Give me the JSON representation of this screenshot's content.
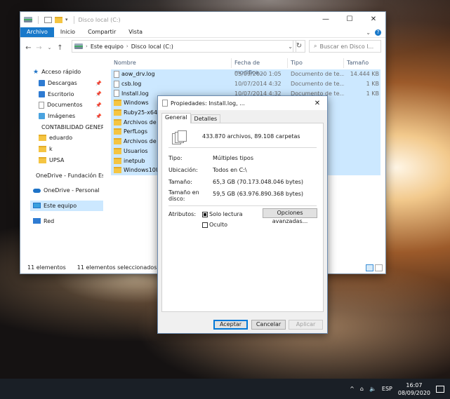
{
  "explorer": {
    "title": "Disco local (C:)",
    "ribbon_tabs": [
      "Archivo",
      "Inicio",
      "Compartir",
      "Vista"
    ],
    "address": [
      "Este equipo",
      "Disco local (C:)"
    ],
    "search_placeholder": "Buscar en Disco l...",
    "sidebar": [
      {
        "label": "Acceso rápido",
        "icon": "star-icon"
      },
      {
        "label": "Descargas",
        "icon": "download-icon",
        "pinned": true
      },
      {
        "label": "Escritorio",
        "icon": "desktop-icon",
        "pinned": true
      },
      {
        "label": "Documentos",
        "icon": "documents-icon",
        "pinned": true
      },
      {
        "label": "Imágenes",
        "icon": "pictures-icon",
        "pinned": true
      },
      {
        "label": "CONTABILIDAD GENER",
        "icon": "folder-icon"
      },
      {
        "label": "eduardo",
        "icon": "folder-icon"
      },
      {
        "label": "k",
        "icon": "folder-icon"
      },
      {
        "label": "UPSA",
        "icon": "folder-icon"
      },
      {
        "label": "OneDrive - Fundación Es",
        "icon": "onedrive-icon"
      },
      {
        "label": "OneDrive - Personal",
        "icon": "onedrive-icon"
      },
      {
        "label": "Este equipo",
        "icon": "this-pc-icon"
      },
      {
        "label": "Red",
        "icon": "network-icon"
      }
    ],
    "columns": [
      "Nombre",
      "Fecha de modifica...",
      "Tipo",
      "Tamaño"
    ],
    "files": [
      {
        "name": "aow_drv.log",
        "date": "05/09/2020 1:05",
        "type": "Documento de te...",
        "size": "14.444 KB",
        "kind": "doc"
      },
      {
        "name": "csb.log",
        "date": "10/07/2014 4:32",
        "type": "Documento de te...",
        "size": "1 KB",
        "kind": "doc"
      },
      {
        "name": "Install.log",
        "date": "10/07/2014 4:32",
        "type": "Documento de te...",
        "size": "1 KB",
        "kind": "doc"
      },
      {
        "name": "Windows",
        "date": "",
        "type": "rchivos",
        "size": "",
        "kind": "folder"
      },
      {
        "name": "Ruby25-x64",
        "date": "",
        "type": "rchivos",
        "size": "",
        "kind": "folder"
      },
      {
        "name": "Archivos de pr",
        "date": "",
        "type": "rchivos",
        "size": "",
        "kind": "folder"
      },
      {
        "name": "PerfLogs",
        "date": "",
        "type": "rchivos",
        "size": "",
        "kind": "folder"
      },
      {
        "name": "Archivos de pr",
        "date": "",
        "type": "rchivos",
        "size": "",
        "kind": "folder"
      },
      {
        "name": "Usuarios",
        "date": "",
        "type": "rchivos",
        "size": "",
        "kind": "folder"
      },
      {
        "name": "inetpub",
        "date": "",
        "type": "rchivos",
        "size": "",
        "kind": "folder"
      },
      {
        "name": "Windows10Up",
        "date": "",
        "type": "rchivos",
        "size": "",
        "kind": "folder"
      }
    ],
    "status_count": "11 elementos",
    "status_selected": "11 elementos seleccionados"
  },
  "dialog": {
    "title": "Propiedades: Install.log, ...",
    "tabs": [
      "General",
      "Detalles"
    ],
    "summary": "433.870 archivos, 89.108 carpetas",
    "type_label": "Tipo:",
    "type_value": "Múltiples tipos",
    "location_label": "Ubicación:",
    "location_value": "Todos en C:\\",
    "size_label": "Tamaño:",
    "size_value": "65,3 GB (70.173.048.046 bytes)",
    "disk_label": "Tamaño en disco:",
    "disk_value": "59,5 GB (63.976.890.368 bytes)",
    "attrs_label": "Atributos:",
    "readonly_label": "Solo lectura",
    "hidden_label": "Oculto",
    "advanced_label": "Opciones avanzadas...",
    "ok_label": "Aceptar",
    "cancel_label": "Cancelar",
    "apply_label": "Aplicar"
  },
  "taskbar": {
    "lang": "ESP",
    "time": "16:07",
    "date": "08/09/2020"
  }
}
